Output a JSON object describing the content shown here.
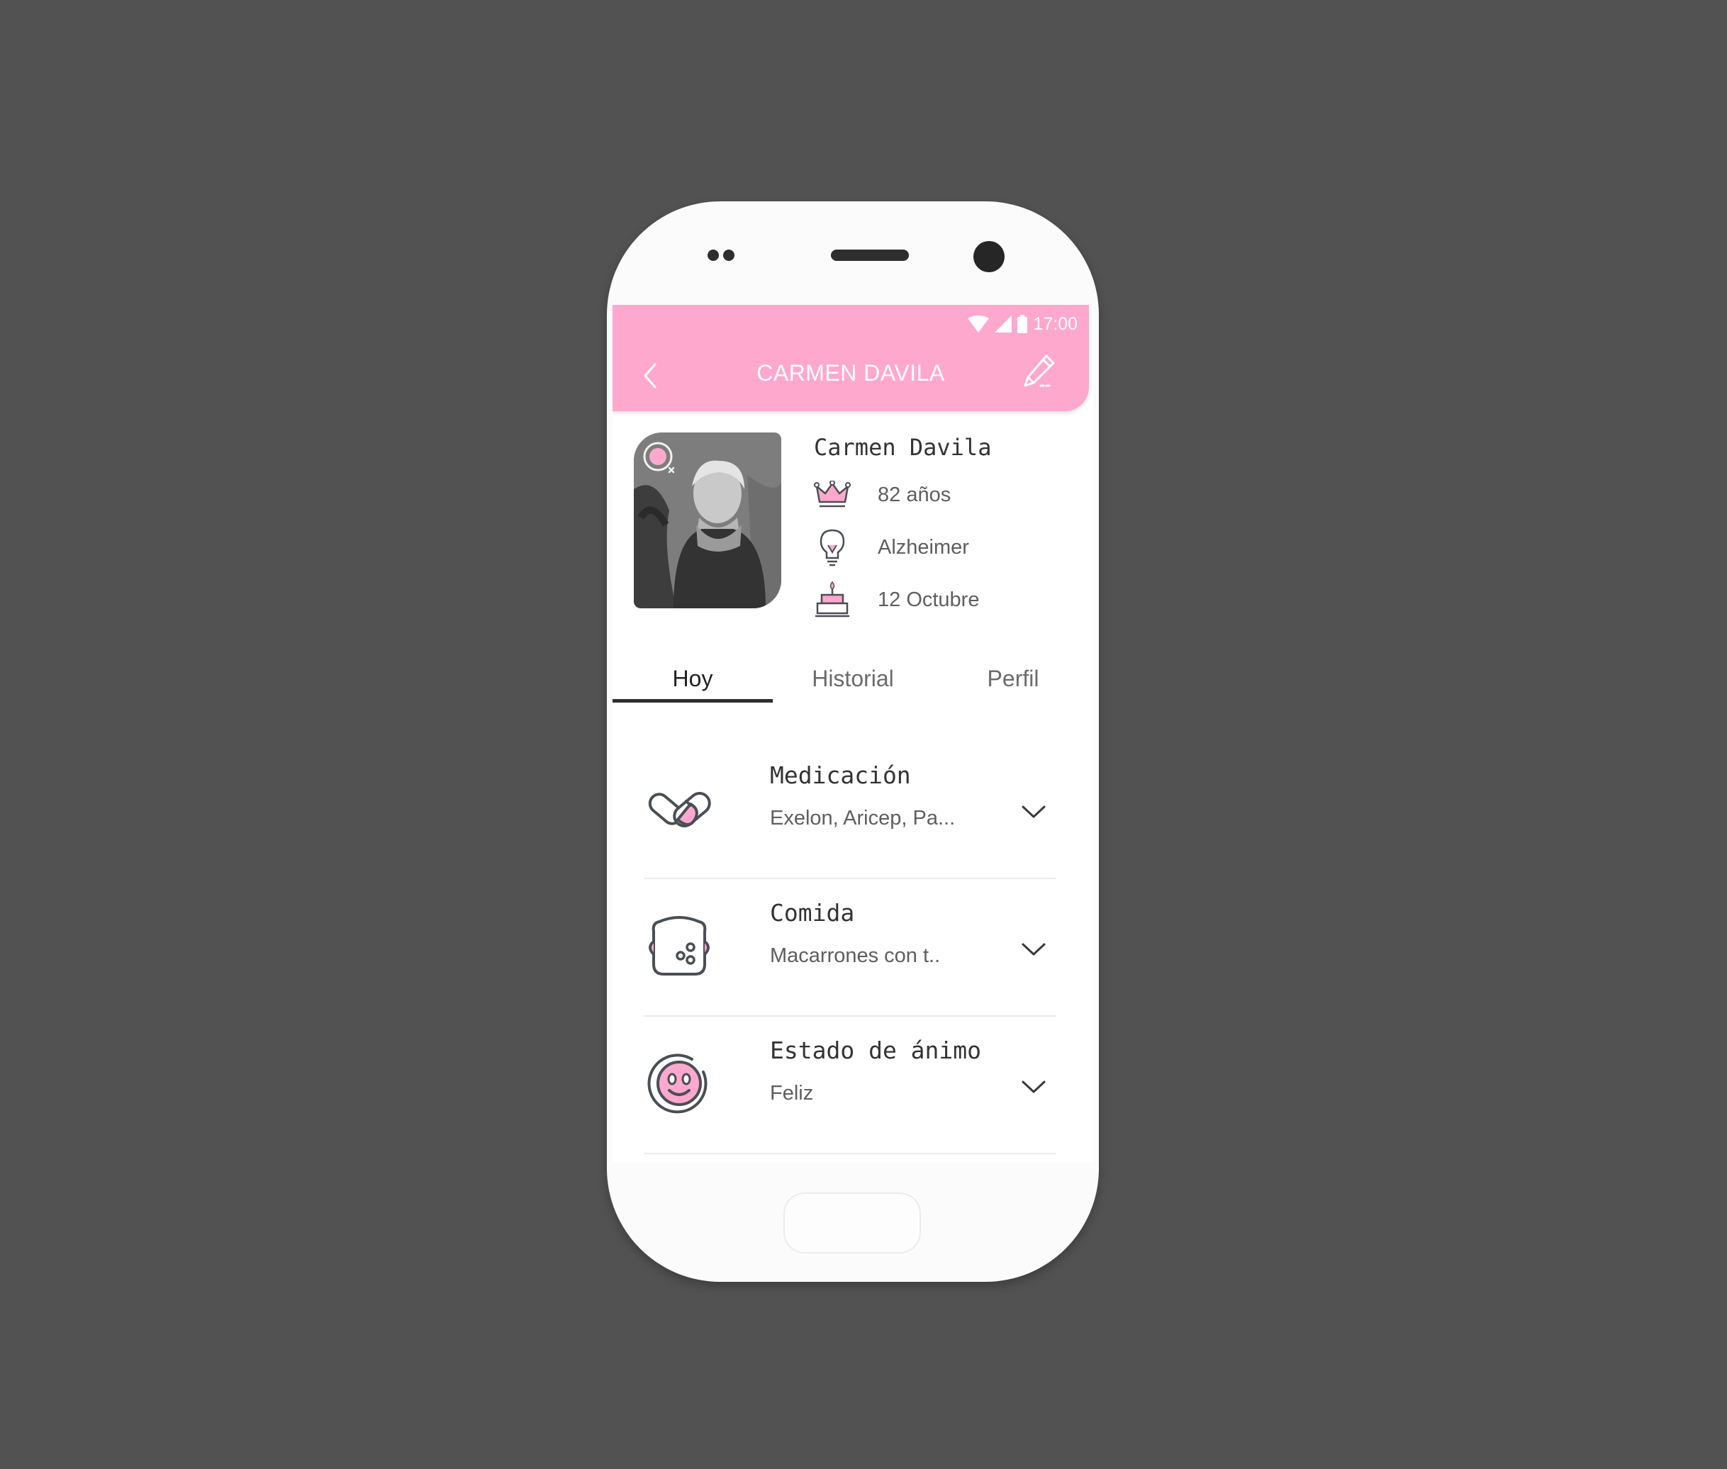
{
  "status_bar": {
    "time": "17:00"
  },
  "app_bar": {
    "title": "CARMEN DAVILA"
  },
  "profile": {
    "name": "Carmen Davila",
    "age": "82 años",
    "condition": "Alzheimer",
    "birthday": "12 Octubre"
  },
  "tabs": [
    {
      "label": "Hoy"
    },
    {
      "label": "Historial"
    },
    {
      "label": "Perfil"
    }
  ],
  "cards": [
    {
      "title": "Medicación",
      "subtitle": "Exelon, Aricep, Pa..."
    },
    {
      "title": "Comida",
      "subtitle": "Macarrones con t.."
    },
    {
      "title": "Estado de ánimo",
      "subtitle": "Feliz"
    }
  ],
  "colors": {
    "accent": "#ffa8cd",
    "icon_stroke": "#4a4f55",
    "background": "#525252"
  },
  "icons": {
    "back": "chevron-left-icon",
    "edit": "pencil-icon",
    "age": "crown-icon",
    "condition": "lightbulb-icon",
    "birthday": "cake-icon",
    "medication": "pills-icon",
    "food": "food-icon",
    "mood": "smiley-icon",
    "expand": "chevron-down-icon"
  }
}
